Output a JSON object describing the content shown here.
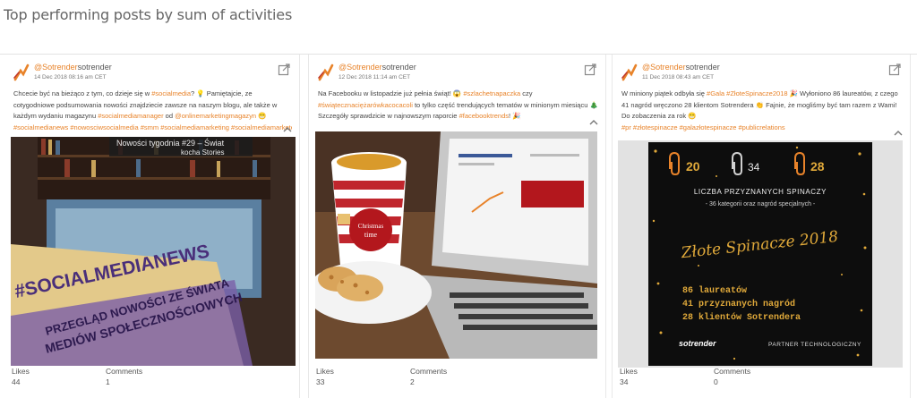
{
  "page": {
    "title": "Top performing posts by sum of activities"
  },
  "colors": {
    "accent": "#e8832a"
  },
  "posts": [
    {
      "author_at": "@Sotrender",
      "author_name": "sotrender",
      "date": "14 Dec 2018 08:16 am CET",
      "text_1": "Chcecie być na bieżąco z tym, co dzieje się w ",
      "tag_1": "#socialmedia",
      "text_2": "? 💡 Pamiętajcie, ze cotygodniowe podsumowania nowości znajdziecie zawsze na naszym blogu, ale także w każdym wydaniu magazynu ",
      "tag_2": "#socialmediamanager",
      "text_3": " od ",
      "tag_3": "@onlinemarketingmagazyn",
      "text_4": " 😁",
      "tags_line": "#socialmedianews #nowosciwsocialmedia #smm #socialmediamarketing #socialmediamarketer",
      "image_text": {
        "banner": "Nowości tygodnia #29 – Świat",
        "banner_2": "kocha Stories",
        "magazine_headline": "#SOCIALMEDIANEWS",
        "magazine_sub_1": "PRZEGLĄD NOWOŚCI ZE ŚWIATA",
        "magazine_sub_2": "MEDIÓW SPOŁECZNOŚCIOWYCH"
      },
      "likes_label": "Likes",
      "likes": "44",
      "comments_label": "Comments",
      "comments": "1"
    },
    {
      "author_at": "@Sotrender",
      "author_name": "sotrender",
      "date": "12 Dec 2018 11:14 am CET",
      "text_1": "Na Facebooku w listopadzie już pełnia świąt! 😱 ",
      "tag_1": "#szlachetnapaczka",
      "text_2": " czy ",
      "tag_2": "#świątecznaciężarówkacocacoli",
      "text_3": " to tylko część trendujących tematów w minionym miesiącu 🎄 Szczegóły sprawdzicie w najnowszym raporcie ",
      "tag_3": "#facebooktrends",
      "text_4": "! 🎉",
      "image_text": {
        "cup_1": "Christmas",
        "cup_2": "time"
      },
      "likes_label": "Likes",
      "likes": "33",
      "comments_label": "Comments",
      "comments": "2"
    },
    {
      "author_at": "@Sotrender",
      "author_name": "sotrender",
      "date": "11 Dec 2018 08:43 am CET",
      "text_1": "W miniony piątek odbyła się ",
      "tag_1": "#Gala",
      "text_2": " ",
      "tag_2": "#ZłoteSpinacze2018",
      "text_3": " 🎉 Wyłoniono 86 laureatów, z czego 41 nagród wręczono 28 klientom Sotrendera 👏 Fajnie, że mogliśmy być tam razem z Wami! Do zobaczenia za rok 😁",
      "tags_line": "#pr #złotespinacze #galazłotespinacze #publicrelations",
      "image_text": {
        "n1": "20",
        "n2": "34",
        "n3": "28",
        "liczba": "LICZBA PRZYZNANYCH SPINACZY",
        "kategorie": "- 36 kategorii oraz nagród specjalnych -",
        "title": "Złote Spinacze 2018",
        "l1": "86 laureatów",
        "l2": "41 przyznanych nagród",
        "l3": "28 klientów Sotrendera",
        "logo": "sotrender",
        "partner": "PARTNER TECHNOLOGICZNY"
      },
      "likes_label": "Likes",
      "likes": "34",
      "comments_label": "Comments",
      "comments": "0"
    }
  ]
}
